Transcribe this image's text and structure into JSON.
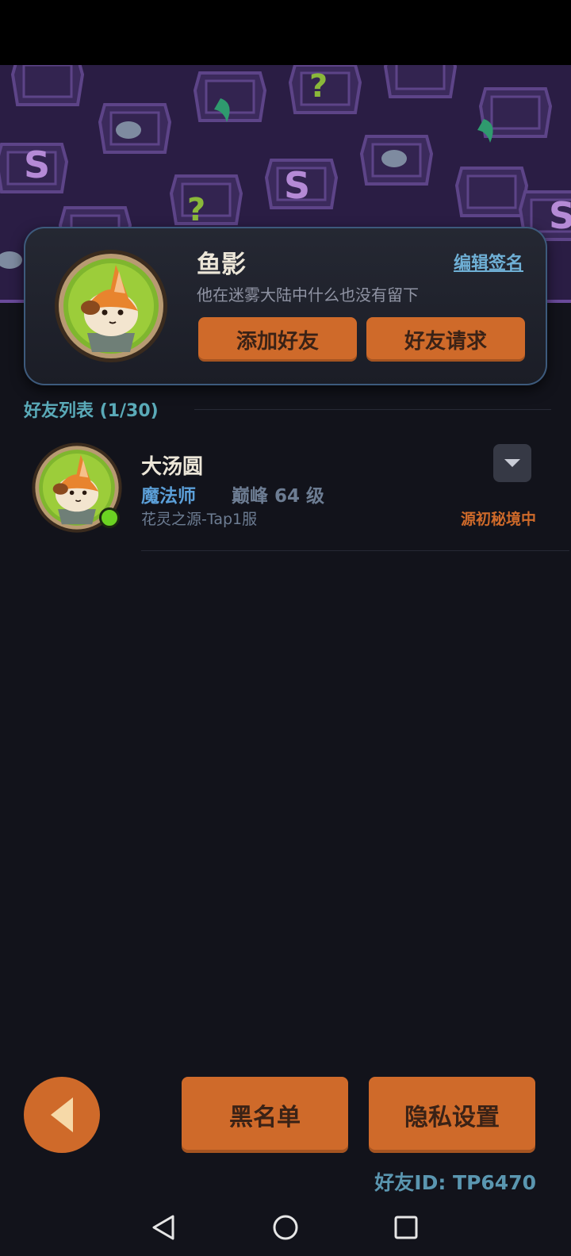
{
  "profile": {
    "name": "鱼影",
    "edit_signature": "编辑签名",
    "signature": "他在迷雾大陆中什么也没有留下",
    "add_friend": "添加好友",
    "friend_requests": "好友请求"
  },
  "friends_section": {
    "title": "好友列表 (1/30)"
  },
  "friends": [
    {
      "name": "大汤圆",
      "class": "魔法师",
      "level": "巅峰 64 级",
      "server": "花灵之源-Tap1服",
      "status": "源初秘境中",
      "online": true
    }
  ],
  "bottom": {
    "blacklist": "黑名单",
    "privacy": "隐私设置",
    "friend_id": "好友ID: TP6470"
  },
  "icons": {
    "back": "back-triangle-icon",
    "dropdown": "chevron-down-icon",
    "nav_back": "nav-back-icon",
    "nav_home": "nav-home-icon",
    "nav_recents": "nav-recents-icon"
  },
  "colors": {
    "accent": "#cf6a2a",
    "background": "#12131b",
    "link": "#6fb0d6",
    "online": "#6bd322",
    "class_color": "#5b9fd8"
  }
}
